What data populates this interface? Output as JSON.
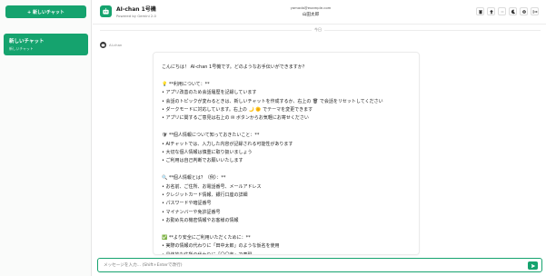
{
  "sidebar": {
    "new_chat_label": "+ 新しいチャット",
    "items": [
      {
        "title": "新しいチャット",
        "subtitle": "新しいチャット"
      }
    ]
  },
  "header": {
    "title": "AI-chan 1号機",
    "subtitle": "Powered by Gemini 2.0",
    "user_email": "yamada@example.com",
    "user_name": "山田太郎",
    "buttons": [
      "delete-icon",
      "share-icon",
      "minus-icon",
      "moon-icon",
      "gear-icon",
      "logout-icon"
    ]
  },
  "chat": {
    "date_label": "今日",
    "bot_name": "AI-chan",
    "message_lines": [
      "こんにちは！ AI-chan 1号機です。どのようなお手伝いができますか？",
      "",
      "💡 **利用について：**",
      "• アプリ改善のため会話履歴を記録しています",
      "• 会話のトピックが変わるときは、新しいチャットを作成するか、右上の 🗑 で会話をリセットしてください",
      "• ダークモードに対応しています。右上の 🌙 🌞 でテーマを変更できます",
      "• アプリに関するご意見は右上の ✉ ボタンからお気軽にお寄せください",
      "",
      "🛡 **個人情報について知っておきたいこと：**",
      "• AIチャットでは、入力した内容が記録される可能性があります",
      "• 大切な個人情報は慎重に取り扱いましょう",
      "• ご利用は自己判断でお願いいたします",
      "",
      "🔍 **個人情報とは？（例）：**",
      "• お名前、ご住所、お電話番号、メールアドレス",
      "• クレジットカード情報、銀行口座の詳細",
      "• パスワードや暗証番号",
      "• マイナンバーや免許証番号",
      "• お勤め先の機密情報やお客様の情報",
      "",
      "✅ **より安全にご利用いただくために：**",
      "• 実際の情報の代わりに「田中太郎」のような仮名を使用",
      "• 具体的な住所の代わりに「〇〇市」で表現"
    ]
  },
  "input": {
    "placeholder": "メッセージを入力... (Shift+Enterで改行)",
    "value": ""
  },
  "colors": {
    "accent": "#15a36e",
    "border": "#ececec"
  }
}
